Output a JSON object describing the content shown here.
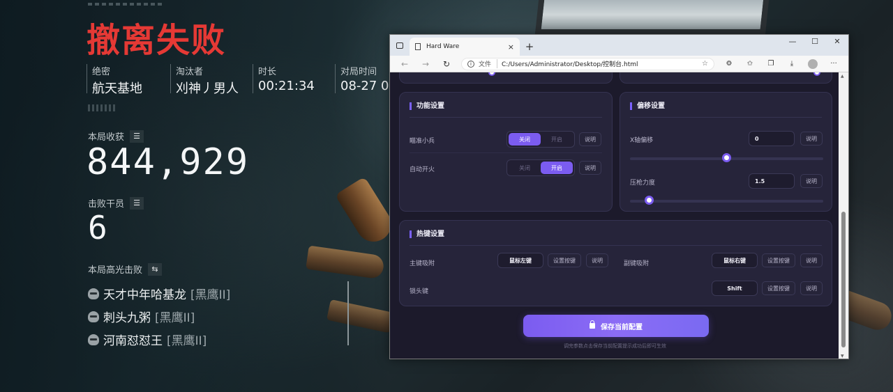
{
  "game": {
    "title": "撤离失败",
    "stats": [
      {
        "label": "绝密",
        "value": "航天基地"
      },
      {
        "label": "淘汰者",
        "value": "刈神丿男人"
      },
      {
        "label": "时长",
        "value": "00:21:34"
      },
      {
        "label": "对局时间",
        "value": "08-27 0"
      }
    ],
    "loot_label": "本局收获",
    "loot_value": "844,929",
    "kills_label": "击败干员",
    "kills_value": "6",
    "highlight_label": "本局高光击败",
    "highlight_kills": [
      {
        "name": "天才中年哈基龙",
        "tag": "[黑鹰II]"
      },
      {
        "name": "刺头九粥",
        "tag": "[黑鹰II]"
      },
      {
        "name": "河南怼怼王",
        "tag": "[黑鹰II]"
      }
    ]
  },
  "browser": {
    "tab_title": "Hard Ware",
    "tab_close": "×",
    "new_tab": "+",
    "window_controls": {
      "minimize": "—",
      "maximize": "☐",
      "close": "✕"
    },
    "nav": {
      "back": "←",
      "forward": "→",
      "refresh": "↻"
    },
    "address": {
      "label": "文件",
      "url": "C:/Users/Administrator/Desktop/控制台.html"
    },
    "toolbar_icons": [
      "star-icon",
      "extensions-icon",
      "favorites-icon",
      "collections-icon",
      "downloads-icon",
      "profile-icon",
      "more-icon"
    ],
    "more": "···"
  },
  "app": {
    "function_settings": {
      "title": "功能设置",
      "rows": [
        {
          "label": "瞄准小兵",
          "options": [
            "关闭",
            "开启"
          ],
          "selected": 0,
          "help": "说明"
        },
        {
          "label": "自动开火",
          "options": [
            "关闭",
            "开启"
          ],
          "selected": 1,
          "help": "说明"
        }
      ]
    },
    "offset_settings": {
      "title": "偏移设置",
      "rows": [
        {
          "label": "X轴偏移",
          "value": "0",
          "help": "说明",
          "slider_fraction": 0.5
        },
        {
          "label": "压枪力度",
          "value": "1.5",
          "help": "说明",
          "slider_fraction": 0.1
        }
      ]
    },
    "hotkey_settings": {
      "title": "热键设置",
      "rows": [
        {
          "label": "主键吸附",
          "key": "鼠标左键",
          "set": "设置按键",
          "help": "说明"
        },
        {
          "label": "副键吸附",
          "key": "鼠标右键",
          "set": "设置按键",
          "help": "说明"
        },
        {
          "label": "锁头键",
          "key": "Shift",
          "set": "设置按键",
          "help": "说明"
        }
      ]
    },
    "save_button": "保存当前配置",
    "hint": "调完参数点击保存当前配置提示成功后即可生效"
  },
  "colors": {
    "accent": "#7b5cf0",
    "title_red": "#e53935",
    "panel_bg": "#26243a"
  }
}
